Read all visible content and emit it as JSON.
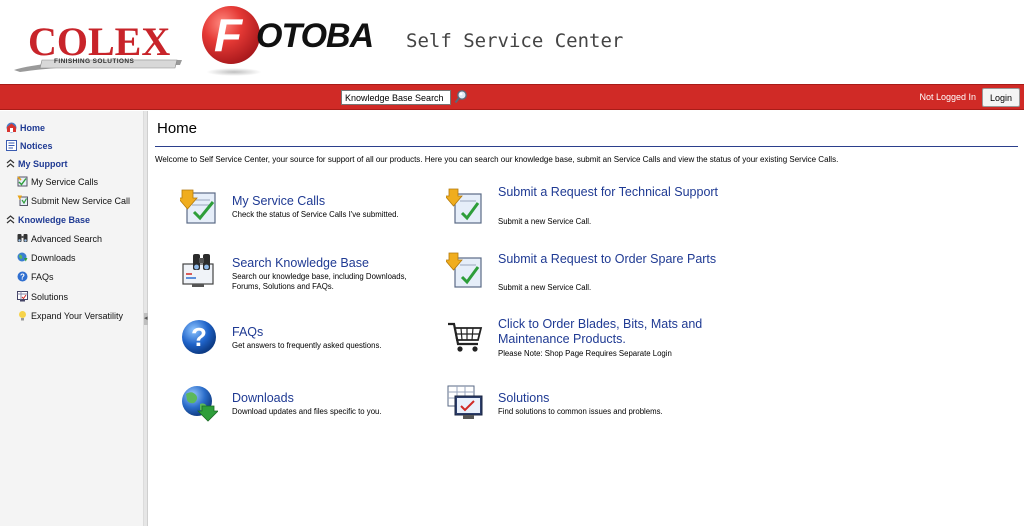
{
  "header": {
    "colex_logo_text": "COLEX",
    "colex_tagline": "FINISHING SOLUTIONS",
    "fotoba_logo_initial": "F",
    "fotoba_logo_rest": "OTOBA",
    "site_title": "Self Service Center"
  },
  "toolbar": {
    "search_value": "Knowledge Base Search",
    "search_icon": "magnifier-icon",
    "login_status": "Not Logged In",
    "login_label": "Login",
    "bar_color": "#d02a26"
  },
  "sidebar": {
    "items": [
      {
        "label": "Home",
        "icon": "home-icon",
        "level": "top"
      },
      {
        "label": "Notices",
        "icon": "notices-icon",
        "level": "top"
      },
      {
        "label": "My Support",
        "icon": "collapse-icon",
        "level": "top"
      },
      {
        "label": "My Service Calls",
        "icon": "service-calls-icon",
        "level": "sub"
      },
      {
        "label": "Submit New Service Call",
        "icon": "submit-call-icon",
        "level": "sub"
      },
      {
        "label": "Knowledge Base",
        "icon": "collapse-icon",
        "level": "top"
      },
      {
        "label": "Advanced Search",
        "icon": "binoculars-icon",
        "level": "sub"
      },
      {
        "label": "Downloads",
        "icon": "globe-download-icon",
        "level": "sub"
      },
      {
        "label": "FAQs",
        "icon": "question-icon",
        "level": "sub"
      },
      {
        "label": "Solutions",
        "icon": "solutions-icon",
        "level": "sub"
      },
      {
        "label": "Expand Your Versatility",
        "icon": "lightbulb-icon",
        "level": "sub"
      }
    ]
  },
  "main": {
    "title": "Home",
    "welcome": "Welcome to Self Service Center, your source for support of all our products. Here you can search our knowledge base, submit an Service Calls and view the status of your existing Service Calls.",
    "tiles": [
      {
        "title": "My Service Calls",
        "desc": "Check the status of Service Calls I've submitted.",
        "icon": "service-calls-icon"
      },
      {
        "title": "Submit a Request for Technical Support",
        "desc": "Submit a new Service Call.",
        "icon": "submit-call-icon"
      },
      {
        "title": "Search Knowledge Base",
        "desc": "Search our knowledge base, including Downloads, Forums, Solutions and FAQs.",
        "icon": "binoculars-icon"
      },
      {
        "title": "Submit a Request to Order Spare Parts",
        "desc": "Submit a new Service Call.",
        "icon": "submit-call-icon"
      },
      {
        "title": "FAQs",
        "desc": "Get answers to frequently asked questions.",
        "icon": "question-icon"
      },
      {
        "title": "Click to Order Blades, Bits, Mats and Maintenance Products.",
        "desc": "Please Note: Shop Page Requires Separate Login",
        "icon": "shopping-cart-icon"
      },
      {
        "title": "Downloads",
        "desc": "Download updates and files specific to you.",
        "icon": "globe-download-icon"
      },
      {
        "title": "Solutions",
        "desc": "Find solutions to common issues and problems.",
        "icon": "solutions-icon"
      }
    ]
  },
  "colors": {
    "link_blue": "#1f3a93",
    "brand_red": "#c8242a"
  }
}
